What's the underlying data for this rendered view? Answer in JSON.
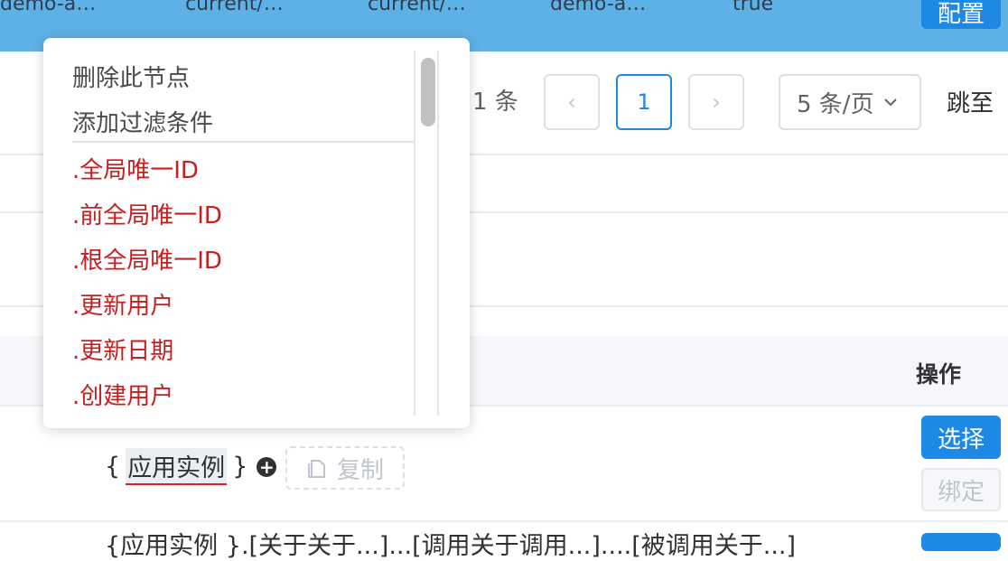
{
  "top_row": {
    "cells": [
      "demo-a…",
      "current/…",
      "current/…",
      "demo-a…",
      "true"
    ],
    "config_label": "配置"
  },
  "pagination": {
    "total_text": "1 条",
    "prev_icon": "‹",
    "current_page": "1",
    "next_icon": "›",
    "page_size": "5 条/页",
    "jump_label": "跳至"
  },
  "table": {
    "ops_header": "操作",
    "row": {
      "brace_open": "{",
      "instance_label": "应用实例",
      "brace_close": "}",
      "plus_icon": "+",
      "copy_label": "复制",
      "select_label": "选择",
      "bind_label": "绑定"
    },
    "next_row_text": "{应用实例 }.[关于关于...]...[调用关于调用...]....[被调用关于...]"
  },
  "context_menu": {
    "actions": [
      "删除此节点",
      "添加过滤条件"
    ],
    "fields": [
      ".全局唯一ID",
      ".前全局唯一ID",
      ".根全局唯一ID",
      ".更新用户",
      ".更新日期",
      ".创建用户"
    ]
  },
  "colors": {
    "highlight_row": "#5eb1e6",
    "primary": "#1e88e5",
    "field_red": "#c81e1e"
  }
}
